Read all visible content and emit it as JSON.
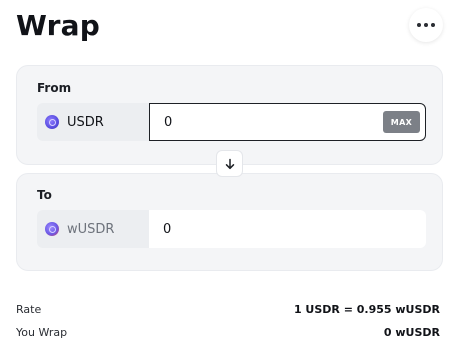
{
  "header": {
    "title": "Wrap",
    "more_icon": "more-horizontal-icon"
  },
  "from": {
    "label": "From",
    "token": "USDR",
    "token_icon": "usdr-token-icon",
    "amount": "0",
    "max_label": "MAX"
  },
  "swap_icon": "arrow-down-icon",
  "to": {
    "label": "To",
    "token": "wUSDR",
    "token_icon": "wusdr-token-icon",
    "amount": "0"
  },
  "summary": {
    "rate_label": "Rate",
    "rate_value": "1 USDR = 0.955 wUSDR",
    "you_wrap_label": "You Wrap",
    "you_wrap_value": "0 wUSDR"
  },
  "colors": {
    "card_bg": "#f4f5f7",
    "max_button_bg": "#7c8087",
    "token_accent": "#5a4ee0"
  }
}
